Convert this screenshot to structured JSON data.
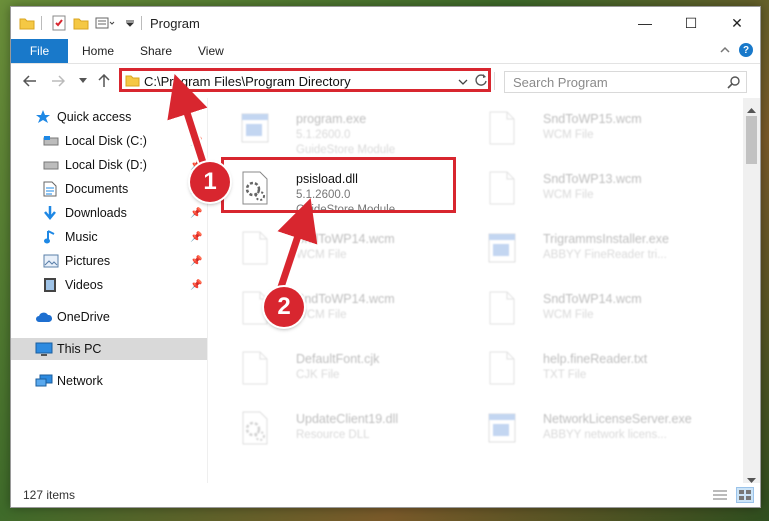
{
  "window": {
    "title": "Program",
    "controls": {
      "minimize": "—",
      "maximize": "☐",
      "close": "✕"
    }
  },
  "ribbon": {
    "tabs": [
      {
        "label": "File"
      },
      {
        "label": "Home"
      },
      {
        "label": "Share"
      },
      {
        "label": "View"
      }
    ]
  },
  "address": {
    "path": "C:\\Program Files\\Program Directory"
  },
  "search": {
    "placeholder": "Search Program"
  },
  "sidebar": {
    "items": [
      {
        "label": "Quick access",
        "icon": "star-icon"
      },
      {
        "label": "Local Disk (C:)",
        "icon": "drive-icon",
        "pinned": true
      },
      {
        "label": "Local Disk (D:)",
        "icon": "drive-icon",
        "pinned": true
      },
      {
        "label": "Documents",
        "icon": "documents-icon",
        "pinned": true
      },
      {
        "label": "Downloads",
        "icon": "downloads-icon",
        "pinned": true
      },
      {
        "label": "Music",
        "icon": "music-icon",
        "pinned": true
      },
      {
        "label": "Pictures",
        "icon": "pictures-icon",
        "pinned": true
      },
      {
        "label": "Videos",
        "icon": "videos-icon",
        "pinned": true
      },
      {
        "label": "OneDrive",
        "icon": "cloud-icon"
      },
      {
        "label": "This PC",
        "icon": "computer-icon",
        "selected": true
      },
      {
        "label": "Network",
        "icon": "network-icon"
      }
    ]
  },
  "files": [
    {
      "name": "program.exe",
      "line1": "5.1.2600.0",
      "line2": "GuideStore Module",
      "icon": "exe-icon",
      "faded": true
    },
    {
      "name": "SndToWP15.wcm",
      "line1": "WCM File",
      "line2": "",
      "icon": "file-icon",
      "faded": true
    },
    {
      "name": "psisload.dll",
      "line1": "5.1.2600.0",
      "line2": "GuideStore Module",
      "icon": "dll-icon",
      "faded": false
    },
    {
      "name": "SndToWP13.wcm",
      "line1": "WCM File",
      "line2": "",
      "icon": "file-icon",
      "faded": true
    },
    {
      "name": "SndToWP14.wcm",
      "line1": "WCM File",
      "line2": "",
      "icon": "file-icon",
      "faded": true
    },
    {
      "name": "TrigrammsInstaller.exe",
      "line1": "ABBYY FineReader tri...",
      "line2": "",
      "icon": "exe-icon",
      "faded": true
    },
    {
      "name": "SndToWP14.wcm",
      "line1": "WCM File",
      "line2": "",
      "icon": "file-icon",
      "faded": true
    },
    {
      "name": "SndToWP14.wcm",
      "line1": "WCM File",
      "line2": "",
      "icon": "file-icon",
      "faded": true
    },
    {
      "name": "DefaultFont.cjk",
      "line1": "CJK File",
      "line2": "",
      "icon": "file-icon",
      "faded": true
    },
    {
      "name": "help.fineReader.txt",
      "line1": "TXT File",
      "line2": "",
      "icon": "file-icon",
      "faded": true
    },
    {
      "name": "UpdateClient19.dll",
      "line1": "Resource DLL",
      "line2": "",
      "icon": "dll-icon",
      "faded": true
    },
    {
      "name": "NetworkLicenseServer.exe",
      "line1": "ABBYY network licens...",
      "line2": "",
      "icon": "exe-icon",
      "faded": true
    }
  ],
  "status": {
    "count": "127 items"
  },
  "callouts": [
    {
      "label": "1"
    },
    {
      "label": "2"
    }
  ],
  "colors": {
    "accent": "#1979ca",
    "highlight": "#d8262f",
    "selected": "#d9d9d9"
  }
}
